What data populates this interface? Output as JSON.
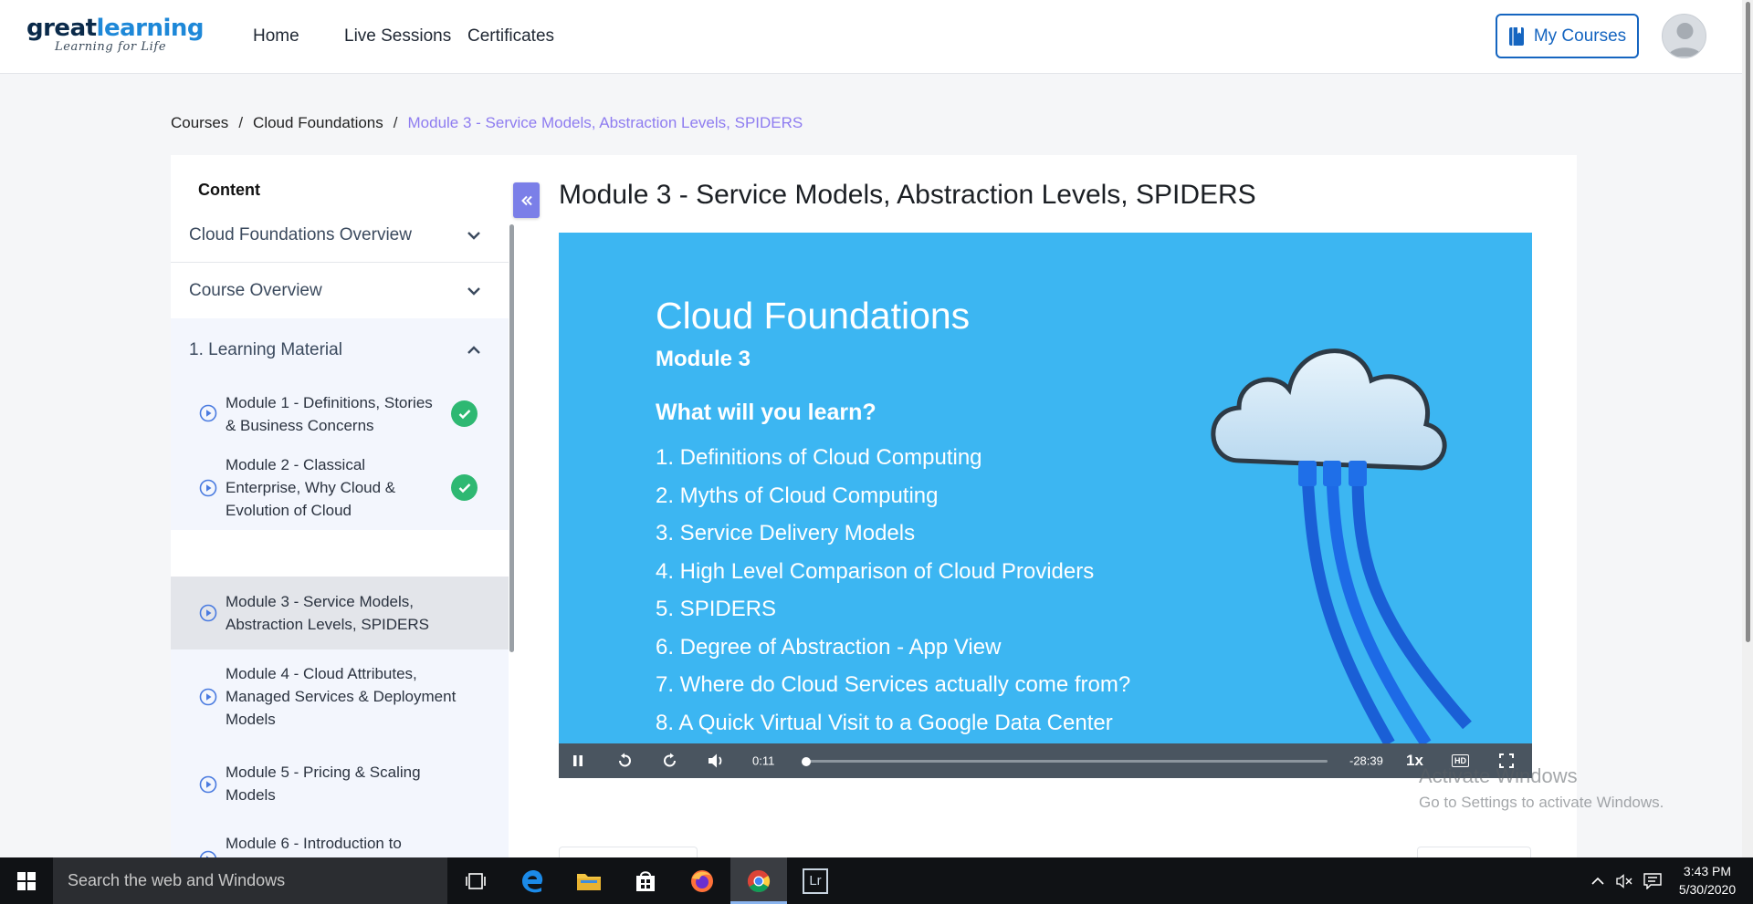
{
  "header": {
    "logo_main_1": "great",
    "logo_main_2": "learning",
    "logo_sub": "Learning for Life",
    "nav": [
      "Home",
      "Live Sessions",
      "Certificates"
    ],
    "my_courses_label": "My Courses",
    "accent_color": "#1565c0"
  },
  "breadcrumb": {
    "items": [
      "Courses",
      "Cloud Foundations"
    ],
    "separator": "/",
    "current": "Module 3 - Service Models, Abstraction Levels, SPIDERS",
    "current_color": "#8e7cf0"
  },
  "sidebar": {
    "heading": "Content",
    "sections": [
      {
        "label": "Cloud Foundations Overview",
        "expanded": false
      },
      {
        "label": "Course Overview",
        "expanded": false
      },
      {
        "label": "1. Learning Material",
        "expanded": true
      }
    ],
    "items": [
      {
        "label_lines": [
          "Module 1 - Definitions, Stories",
          "& Business Concerns"
        ],
        "completed": true
      },
      {
        "label_lines": [
          "Module 2 - Classical",
          "Enterprise, Why Cloud &",
          "Evolution of Cloud"
        ],
        "completed": true
      },
      {
        "label_lines": [
          "Module 3 - Service Models,",
          "Abstraction Levels, SPIDERS"
        ],
        "completed": false,
        "active": true
      },
      {
        "label_lines": [
          "Module 4 - Cloud Attributes,",
          "Managed Services & Deployment",
          "Models"
        ],
        "completed": false
      },
      {
        "label_lines": [
          "Module 5 - Pricing & Scaling",
          "Models"
        ],
        "completed": false
      },
      {
        "label_lines": [
          "Module 6 - Introduction to"
        ],
        "completed": false
      }
    ],
    "collapse_icon": "double-chevron-left-icon"
  },
  "lesson": {
    "title": "Module 3 - Service Models, Abstraction Levels, SPIDERS"
  },
  "video": {
    "slide_title": "Cloud Foundations",
    "slide_subtitle": "Module 3",
    "slide_question": "What will you learn?",
    "slide_items": [
      "1. Definitions of Cloud Computing",
      "2. Myths of Cloud Computing",
      "3. Service Delivery Models",
      "4. High Level Comparison of Cloud Providers",
      "5. SPIDERS",
      "6. Degree of Abstraction - App View",
      "7. Where do Cloud Services actually come from?",
      "8. A Quick Virtual Visit to a Google Data Center"
    ],
    "current_time": "0:11",
    "remaining_time": "-28:39",
    "progress_fraction": 0.006,
    "speed": "1x",
    "hd_label": "HD",
    "background_color": "#3cb6f2"
  },
  "watermark": {
    "line1": "Activate Windows",
    "line2": "Go to Settings to activate Windows."
  },
  "taskbar": {
    "search_placeholder": "Search the web and Windows",
    "lightroom_label": "Lr",
    "time": "3:43 PM",
    "date": "5/30/2020"
  }
}
